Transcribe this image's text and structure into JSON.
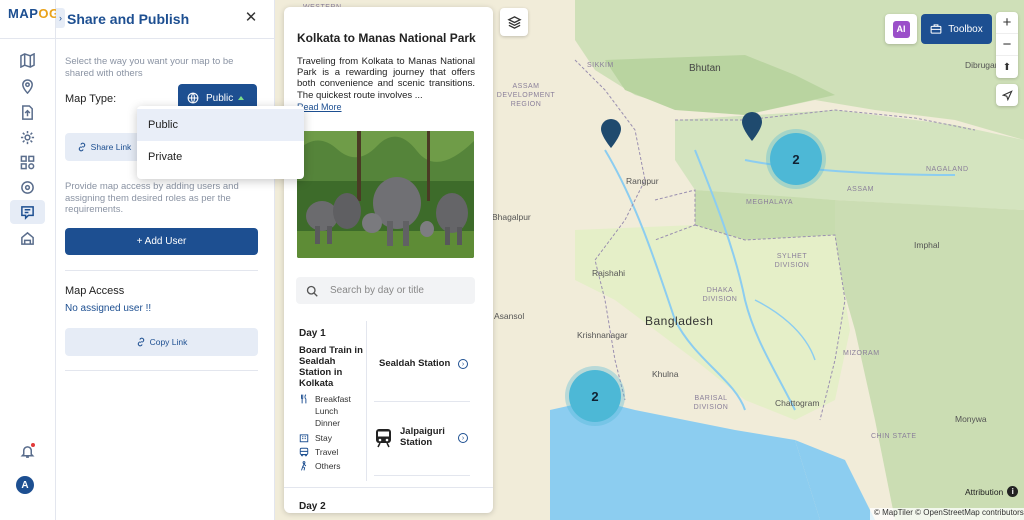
{
  "app": {
    "logo_main": "MAP",
    "logo_accent": "OG"
  },
  "panel": {
    "title": "Share and Publish",
    "help_share": "Select the way you want your map to be shared with others",
    "map_type_label": "Map Type:",
    "map_type_value": "Public",
    "share_link_label": "Share Link",
    "help_users": "Provide map access by adding users and assigning them desired roles as per the requirements.",
    "add_user_label": "+ Add User",
    "map_access_title": "Map Access",
    "no_user_text": "No assigned user !!",
    "copy_link_label": "Copy Link"
  },
  "dropdown": {
    "options": [
      "Public",
      "Private"
    ],
    "selected": "Public"
  },
  "card": {
    "title": "Kolkata to Manas National Park",
    "description": "Traveling from Kolkata to Manas National Park is a rewarding journey that offers both convenience and scenic transitions. The quickest route involves ...",
    "read_more": "Read More",
    "search_placeholder": "Search by day or title",
    "day1": {
      "label": "Day 1",
      "activity": "Board Train in Sealdah Station in Kolkata",
      "meals": "Breakfast Lunch Dinner",
      "stay": "Stay",
      "travel": "Travel",
      "others": "Others",
      "stations": [
        "Sealdah Station",
        "Jalpaiguri Station"
      ]
    },
    "day2": {
      "label": "Day 2"
    }
  },
  "map": {
    "labels": {
      "western": "WESTERN",
      "sikkim": "SIKKIM",
      "assam_dev": "ASSAM DEVELOPMENT REGION",
      "bhutan": "Bhutan",
      "dibrugarh": "Dibrugarh",
      "rangpur": "Rangpur",
      "assam": "ASSAM",
      "nagaland": "NAGALAND",
      "meghalaya": "MEGHALAYA",
      "bhagalpur": "Bhagalpur",
      "imphal": "Imphal",
      "sylhet": "SYLHET DIVISION",
      "rajshahi": "Rajshahi",
      "dhaka": "DHAKA DIVISION",
      "asansol": "Asansol",
      "bangladesh": "Bangladesh",
      "krishnanagar": "Krishnanagar",
      "mizoram": "MIZORAM",
      "khulna": "Khulna",
      "barisal": "BARISAL DIVISION",
      "chattogram": "Chattogram",
      "monywa": "Monywa",
      "chin": "CHIN STATE"
    },
    "clusters": [
      {
        "id": "cluster-north",
        "count": "2"
      },
      {
        "id": "cluster-south",
        "count": "2"
      }
    ],
    "toolbox_label": "Toolbox",
    "ai_label": "AI",
    "attribution_label": "Attribution",
    "copyright": "© MapTiler © OpenStreetMap contributors",
    "zoom_in": "+",
    "zoom_out": "−",
    "compass": "⬆"
  },
  "colors": {
    "brand": "#1d4f91",
    "accent": "#e9a21b",
    "cluster": "#4db8d6",
    "water": "#8ccdf0"
  }
}
